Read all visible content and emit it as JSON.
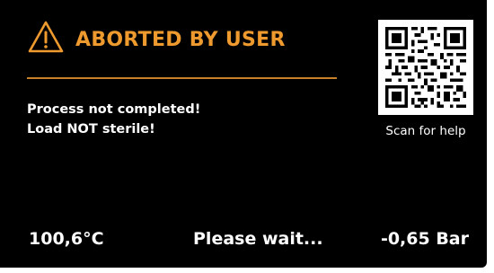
{
  "alert": {
    "icon": "warning-triangle-icon",
    "title": "ABORTED BY USER",
    "accent_color": "#ee9a2e"
  },
  "messages": {
    "line1": "Process not completed!",
    "line2": "Load NOT sterile!"
  },
  "help": {
    "icon": "qr-code-icon",
    "caption": "Scan for help"
  },
  "readouts": {
    "temperature": "100,6°C",
    "status": "Please wait...",
    "pressure": "-0,65 Bar"
  }
}
